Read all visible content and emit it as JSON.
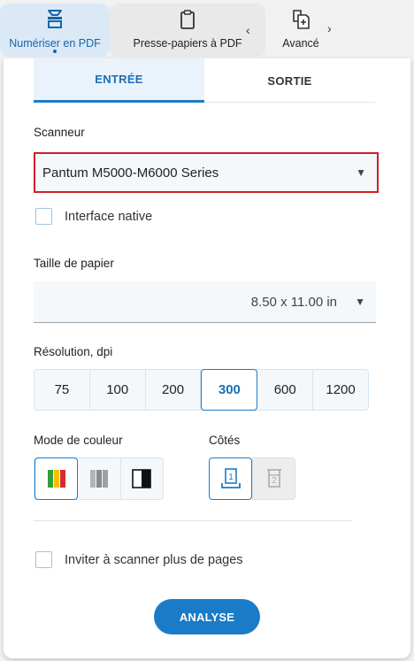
{
  "toolbar": {
    "scan_label": "Numériser en PDF",
    "clipboard_label": "Presse-papiers à PDF",
    "advanced_label": "Avancé",
    "chevron_left": "‹",
    "chevron_right": "›"
  },
  "tabs": {
    "input": "ENTRÉE",
    "output": "SORTIE",
    "active": "input"
  },
  "scanner": {
    "label": "Scanneur",
    "value": "Pantum M5000-M6000 Series"
  },
  "native_interface": {
    "label": "Interface native",
    "checked": false
  },
  "paper": {
    "label": "Taille de papier",
    "value": "8.50 x 11.00 in"
  },
  "resolution": {
    "label": "Résolution, dpi",
    "options": [
      "75",
      "100",
      "200",
      "300",
      "600",
      "1200"
    ],
    "selected": "300"
  },
  "color_mode": {
    "label": "Mode de couleur",
    "options": [
      "color-icon",
      "grayscale-icon",
      "black-white-icon"
    ],
    "selected": "color-icon"
  },
  "sides": {
    "label": "Côtés",
    "options": [
      "1",
      "2"
    ],
    "selected": "1"
  },
  "more_pages": {
    "label": "Inviter à scanner plus de pages",
    "checked": false
  },
  "analyse_button": "ANALYSE",
  "colors": {
    "accent": "#1a7cc9",
    "highlight_border": "#cf2027",
    "field_bg": "#f4f8fb"
  }
}
